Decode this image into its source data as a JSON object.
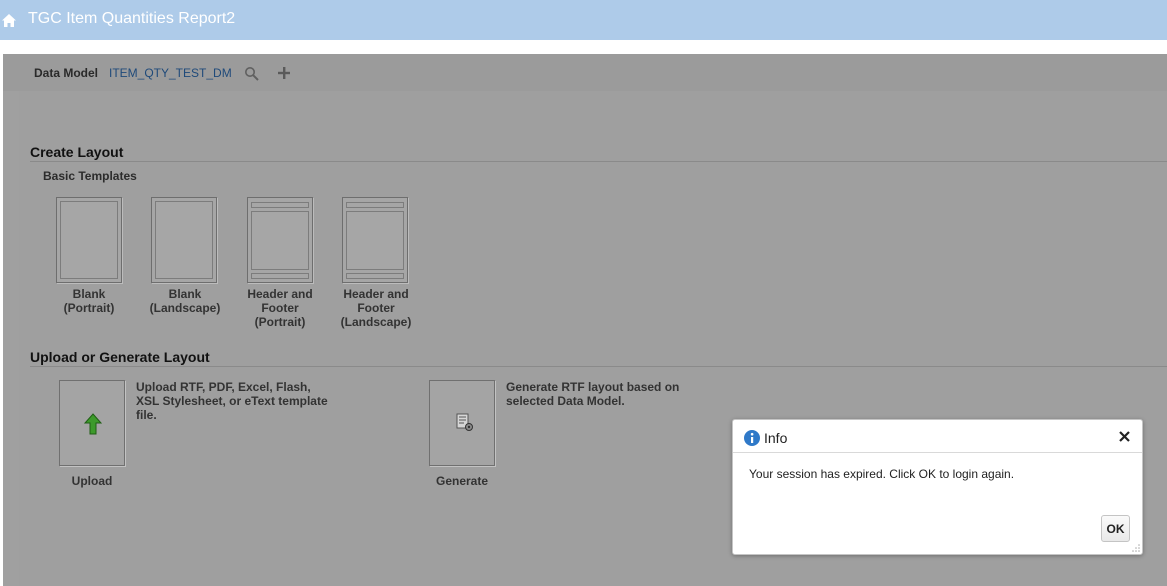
{
  "header": {
    "title": "TGC Item Quantities Report2",
    "icon": "home-icon"
  },
  "data_model": {
    "label": "Data Model",
    "value": "ITEM_QTY_TEST_DM",
    "search_icon": "search-icon",
    "add_icon": "plus-icon"
  },
  "create_layout": {
    "title": "Create Layout",
    "subtitle": "Basic Templates",
    "templates": [
      {
        "line1": "Blank",
        "line2": "(Portrait)",
        "line3": ""
      },
      {
        "line1": "Blank",
        "line2": "(Landscape)",
        "line3": ""
      },
      {
        "line1": "Header and",
        "line2": "Footer",
        "line3": "(Portrait)"
      },
      {
        "line1": "Header and",
        "line2": "Footer",
        "line3": "(Landscape)"
      }
    ]
  },
  "upload_generate": {
    "title": "Upload or Generate Layout",
    "upload": {
      "label": "Upload",
      "description": "Upload RTF, PDF, Excel, Flash, XSL Stylesheet, or eText template file.",
      "icon": "upload-arrow-icon"
    },
    "generate": {
      "label": "Generate",
      "description": "Generate RTF layout based on selected Data Model.",
      "icon": "generate-document-icon"
    }
  },
  "dialog": {
    "title": "Info",
    "message": "Your session has expired. Click OK to login again.",
    "ok_label": "OK",
    "icon": "info-icon"
  },
  "colors": {
    "header_bar": "#aecbe9",
    "overlay_gray": "#a0a0a0",
    "link_blue": "#1f4a7a",
    "info_blue": "#2f79c8",
    "upload_green": "#3d9a2b"
  }
}
